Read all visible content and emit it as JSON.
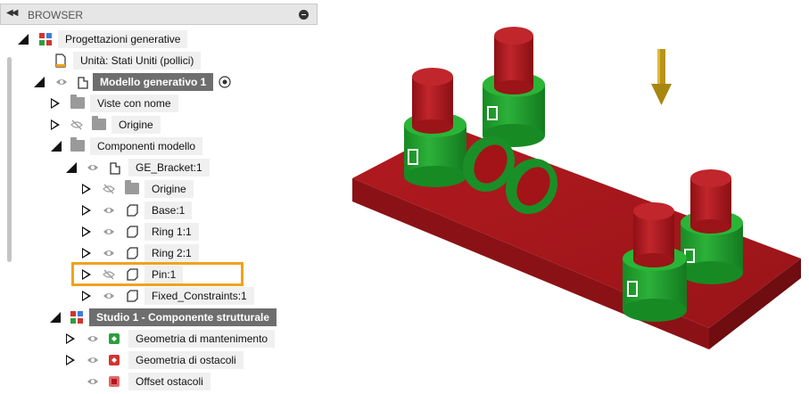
{
  "header": {
    "title": "BROWSER",
    "collapse_icon": "double-chevron-left-icon",
    "minimize_icon": "minus-circle-icon"
  },
  "tree": {
    "root": "Progettazioni generative",
    "units": "Unità: Stati Uniti (pollici)",
    "model": "Modello generativo 1",
    "named_views": "Viste con nome",
    "origin": "Origine",
    "model_components": "Componenti modello",
    "component": "GE_Bracket:1",
    "children": [
      "Origine",
      "Base:1",
      "Ring 1:1",
      "Ring 2:1",
      "Pin:1",
      "Fixed_Constraints:1"
    ],
    "study": "Studio 1 - Componente strutturale",
    "study_items": [
      "Geometria di mantenimento",
      "Geometria di ostacoli",
      "Offset ostacoli"
    ]
  },
  "colors": {
    "accent_highlight": "#f0a21e",
    "part_red": "#b5171d",
    "keep_green": "#1f9a2c",
    "load_gold": "#b89419"
  }
}
